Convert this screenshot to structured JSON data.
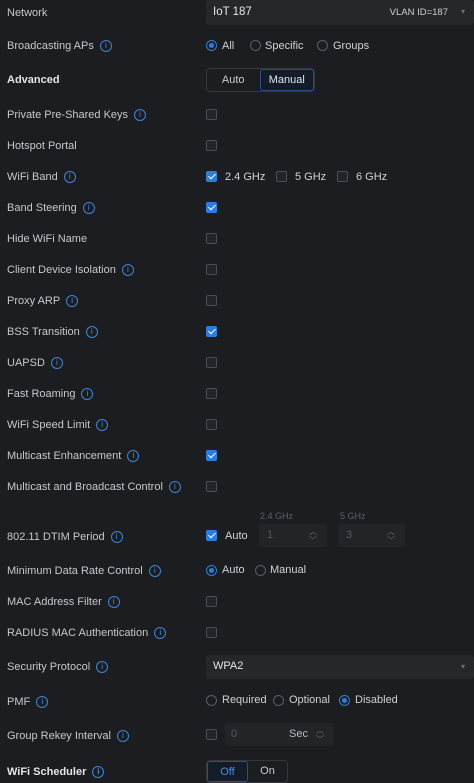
{
  "network": {
    "label": "Network",
    "value": "IoT 187",
    "vlan": "VLAN ID=187"
  },
  "broadcasting": {
    "label": "Broadcasting APs",
    "options": [
      "All",
      "Specific",
      "Groups"
    ]
  },
  "advanced": {
    "label": "Advanced",
    "auto": "Auto",
    "manual": "Manual"
  },
  "rows": {
    "psk": "Private Pre-Shared Keys",
    "hotspot": "Hotspot Portal",
    "wifiband": "WiFi Band",
    "bandsteering": "Band Steering",
    "hidename": "Hide WiFi Name",
    "isolation": "Client Device Isolation",
    "proxyarp": "Proxy ARP",
    "bss": "BSS Transition",
    "uapsd": "UAPSD",
    "fastroam": "Fast Roaming",
    "speedlimit": "WiFi Speed Limit",
    "multicast": "Multicast Enhancement",
    "mbcontrol": "Multicast and Broadcast Control",
    "dtim": "802.11 DTIM Period",
    "mindata": "Minimum Data Rate Control",
    "macfilter": "MAC Address Filter",
    "radius": "RADIUS MAC Authentication",
    "security": "Security Protocol",
    "pmf": "PMF",
    "rekey": "Group Rekey Interval",
    "scheduler": "WiFi Scheduler"
  },
  "wifiband": {
    "b24": "2.4 GHz",
    "b5": "5 GHz",
    "b6": "6 GHz"
  },
  "dtim": {
    "auto": "Auto",
    "h24": "2.4 GHz",
    "h5": "5 GHz",
    "v24": "1",
    "v5": "3"
  },
  "mindata": {
    "auto": "Auto",
    "manual": "Manual"
  },
  "security": {
    "value": "WPA2"
  },
  "pmf": {
    "options": [
      "Required",
      "Optional",
      "Disabled"
    ]
  },
  "rekey": {
    "placeholder": "0",
    "unit": "Sec"
  },
  "scheduler": {
    "off": "Off",
    "on": "On"
  },
  "info_glyph": "i",
  "colors": {
    "accent": "#2f7ddb",
    "background": "#1c1d20",
    "field": "#26272b"
  }
}
